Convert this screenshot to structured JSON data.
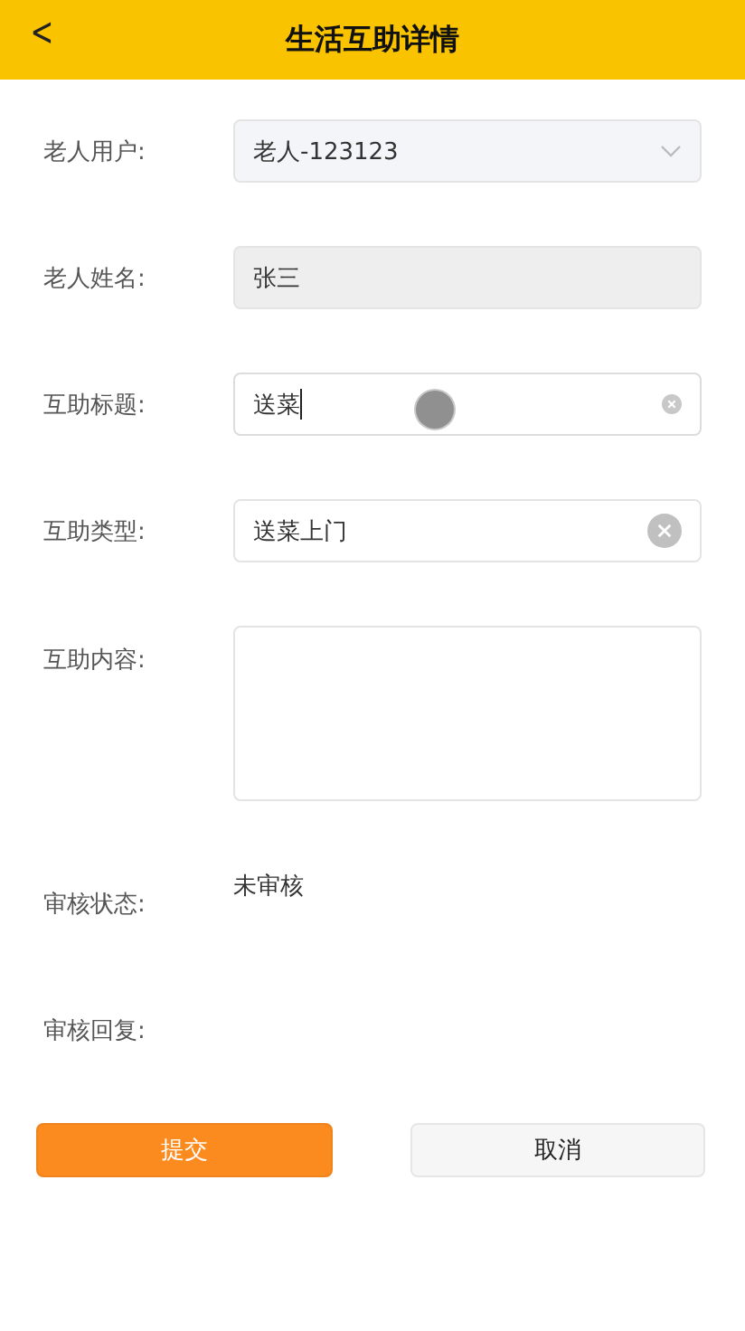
{
  "header": {
    "back": "<",
    "title": "生活互助详情"
  },
  "fields": [
    {
      "kind": "select",
      "label": "老人用户:",
      "value": "老人-123123"
    },
    {
      "kind": "readonly",
      "label": "老人姓名:",
      "value": "张三"
    },
    {
      "kind": "text",
      "label": "互助标题:",
      "value": "送菜",
      "focused": true
    },
    {
      "kind": "picker",
      "label": "互助类型:",
      "value": "送菜上门",
      "focused": false
    },
    {
      "kind": "textarea",
      "label": "互助内容:"
    },
    {
      "kind": "status",
      "label": "审核状态:",
      "value": "未审核"
    },
    {
      "kind": "plain",
      "label": "审核回复:"
    }
  ],
  "buttons": [
    {
      "kind": "primary",
      "label": "提交"
    },
    {
      "kind": "secondary",
      "label": "取消"
    }
  ]
}
